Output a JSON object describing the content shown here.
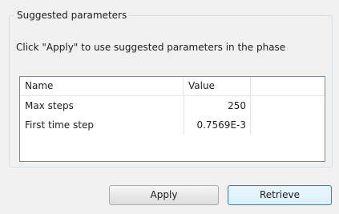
{
  "group": {
    "title": "Suggested parameters",
    "instruction": "Click \"Apply\" to use suggested parameters in the phase"
  },
  "table": {
    "columns": [
      "Name",
      "Value"
    ],
    "rows": [
      {
        "name": "Max steps",
        "value": "250"
      },
      {
        "name": "First time step",
        "value": "0.7569E-3"
      }
    ]
  },
  "buttons": {
    "apply": "Apply",
    "retrieve": "Retrieve"
  }
}
